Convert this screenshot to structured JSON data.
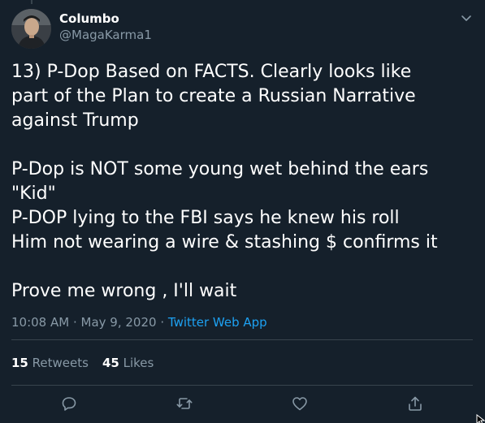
{
  "author": {
    "display_name": "Columbo",
    "handle": "@MagaKarma1"
  },
  "tweet": {
    "text": "13) P-Dop Based on FACTS. Clearly looks like\npart of the Plan to create a Russian Narrative\nagainst Trump\n\nP-Dop is NOT some young wet behind the ears\n\"Kid\"\nP-DOP lying to the FBI says he knew his roll\nHim not wearing a wire & stashing $ confirms it\n\nProve me wrong , I'll wait",
    "timestamp": "10:08 AM · May 9, 2020",
    "separator": "·",
    "source": "Twitter Web App"
  },
  "stats": {
    "retweets_count": "15",
    "retweets_label": "Retweets",
    "likes_count": "45",
    "likes_label": "Likes"
  },
  "icons": {
    "menu": "chevron-down-icon",
    "reply": "reply-icon",
    "retweet": "retweet-icon",
    "like": "heart-icon",
    "share": "share-icon"
  },
  "colors": {
    "background": "#15202b",
    "text": "#ffffff",
    "secondary_text": "#8899a6",
    "link": "#1da1f2",
    "divider": "#38444d"
  }
}
